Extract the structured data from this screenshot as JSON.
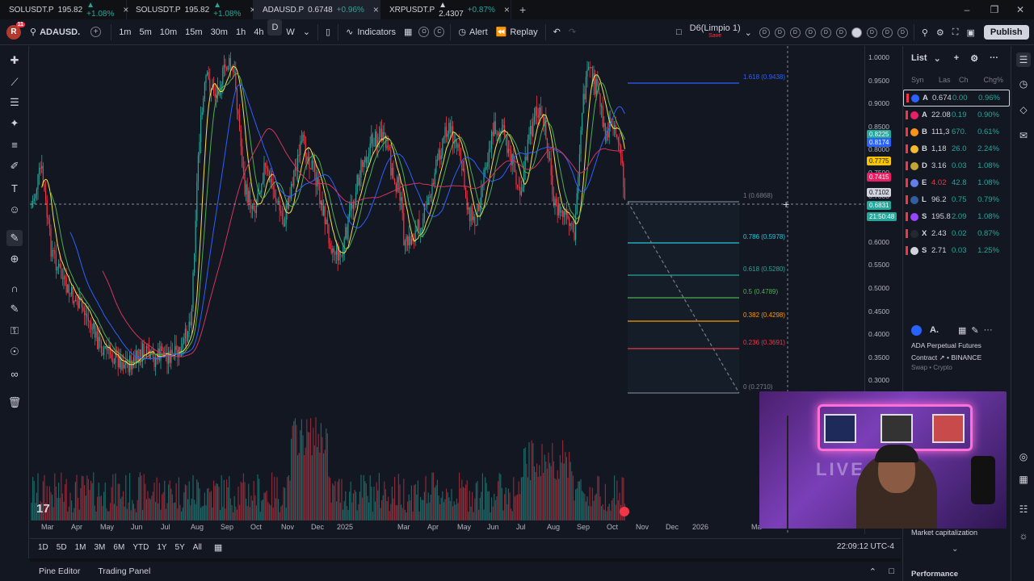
{
  "browser_tabs": [
    {
      "symbol": "SOLUSDT.P",
      "price": "195.82",
      "change": "▲ +1.08%",
      "active": false
    },
    {
      "symbol": "SOLUSDT.P",
      "price": "195.82",
      "change": "▲ +1.08%",
      "active": false
    },
    {
      "symbol": "ADAUSD.P",
      "price": "0.6748",
      "change": "+0.96%",
      "active": true
    },
    {
      "symbol": "XRPUSDT.P",
      "price": "▲ 2.4307",
      "change": "+0.87%",
      "active": false
    }
  ],
  "toolbar": {
    "avatar_letter": "R",
    "avatar_badge": "11",
    "symbol": "ADAUSD.",
    "intervals": [
      "1m",
      "5m",
      "10m",
      "15m",
      "30m",
      "1h",
      "4h",
      "D",
      "W"
    ],
    "active_interval": "D",
    "indicators_label": "Indicators",
    "o_label": "O",
    "c_label": "C",
    "alert_label": "Alert",
    "replay_label": "Replay",
    "layout_name": "D6(Limpio 1)",
    "layout_sub": "Save",
    "publish_label": "Publish"
  },
  "price_axis": {
    "ticks": [
      "1.0000",
      "0.9500",
      "0.9000",
      "0.8500",
      "0.8000",
      "0.7500",
      "0.7000",
      "0.6500",
      "0.6000",
      "0.5500",
      "0.5000",
      "0.4500",
      "0.4000",
      "0.3500",
      "0.3000"
    ],
    "tags": [
      {
        "text": "0.8225",
        "color": "#26a69a"
      },
      {
        "text": "0.8174",
        "color": "#2962ff"
      },
      {
        "text": "0.7775",
        "color": "#f7c500"
      },
      {
        "text": "0.7415",
        "color": "#e91e63"
      },
      {
        "text": "0.7102",
        "color": "#d1d4dc"
      },
      {
        "text": "0.6831",
        "color": "#26a69a"
      },
      {
        "text": "21:50:48",
        "color": "#26a69a"
      }
    ]
  },
  "fib_levels": [
    {
      "label": "1.618 (0.9438)",
      "color": "#2962ff"
    },
    {
      "label": "1 (0.6868)",
      "color": "#787b86"
    },
    {
      "label": "0.786 (0.5978)",
      "color": "#26c6da"
    },
    {
      "label": "0.618 (0.5280)",
      "color": "#26a69a"
    },
    {
      "label": "0.5 (0.4789)",
      "color": "#4caf50"
    },
    {
      "label": "0.382 (0.4298)",
      "color": "#ff9800"
    },
    {
      "label": "0.236 (0.3691)",
      "color": "#f23645"
    },
    {
      "label": "0 (0.2710)",
      "color": "#787b86"
    }
  ],
  "time_axis": [
    "Mar",
    "Apr",
    "May",
    "Jun",
    "Jul",
    "Aug",
    "Sep",
    "Oct",
    "Nov",
    "Dec",
    "2025",
    "Mar",
    "Apr",
    "May",
    "Jun",
    "Jul",
    "Aug",
    "Sep",
    "Oct",
    "Nov",
    "Dec",
    "2026",
    "Ma"
  ],
  "range_bar": {
    "ranges": [
      "1D",
      "5D",
      "1M",
      "3M",
      "6M",
      "YTD",
      "1Y",
      "5Y",
      "All"
    ],
    "clock": "22:09:12 UTC-4"
  },
  "bottom_tabs": [
    "Pine Editor",
    "Trading Panel"
  ],
  "watchlist": {
    "title": "List",
    "columns": [
      "Syn",
      "Las",
      "Ch",
      "Chg%"
    ],
    "rows": [
      {
        "sym": "A",
        "last": "0.674",
        "ch": "0.00",
        "chg": "0.96%",
        "color": "#2962ff",
        "dir": "green"
      },
      {
        "sym": "A",
        "last": "22.08",
        "ch": "0.19",
        "chg": "0.90%",
        "color": "#e91e63",
        "dir": "green"
      },
      {
        "sym": "B",
        "last": "111,3",
        "ch": "670.",
        "chg": "0.61%",
        "color": "#f7931a",
        "dir": "green"
      },
      {
        "sym": "B",
        "last": "1,18",
        "ch": "26.0",
        "chg": "2.24%",
        "color": "#f3ba2f",
        "dir": "green"
      },
      {
        "sym": "D",
        "last": "3.16",
        "ch": "0.03",
        "chg": "1.08%",
        "color": "#c2a633",
        "dir": "green"
      },
      {
        "sym": "E",
        "last": "4.02",
        "ch": "42.8",
        "chg": "1.08%",
        "color": "#627eea",
        "dir": "green",
        "last_red": true
      },
      {
        "sym": "L",
        "last": "96.2",
        "ch": "0.75",
        "chg": "0.79%",
        "color": "#345d9d",
        "dir": "green"
      },
      {
        "sym": "S",
        "last": "195.8",
        "ch": "2.09",
        "chg": "1.08%",
        "color": "#9945ff",
        "dir": "green"
      },
      {
        "sym": "X",
        "last": "2.43",
        "ch": "0.02",
        "chg": "0.87%",
        "color": "#23292f",
        "dir": "green"
      },
      {
        "sym": "S",
        "last": "2.71",
        "ch": "0.03",
        "chg": "1.25%",
        "color": "#d1d4dc",
        "dir": "green"
      }
    ]
  },
  "details": {
    "symbol_short": "A.",
    "name": "ADA Perpetual Futures",
    "contract": "Contract",
    "exchange": "BINANCE",
    "category": "Swap • Crypto",
    "market_cap_label": "Market capitalization",
    "performance_label": "Performance"
  },
  "webcam": {
    "overlay_text": "LIVE"
  },
  "colors": {
    "bg": "#131722",
    "up": "#26a69a",
    "down": "#f23645",
    "ma_yellow": "#f7e14a",
    "ma_green": "#4caf50",
    "ma_blue": "#2962ff",
    "ma_red": "#d5335c"
  }
}
